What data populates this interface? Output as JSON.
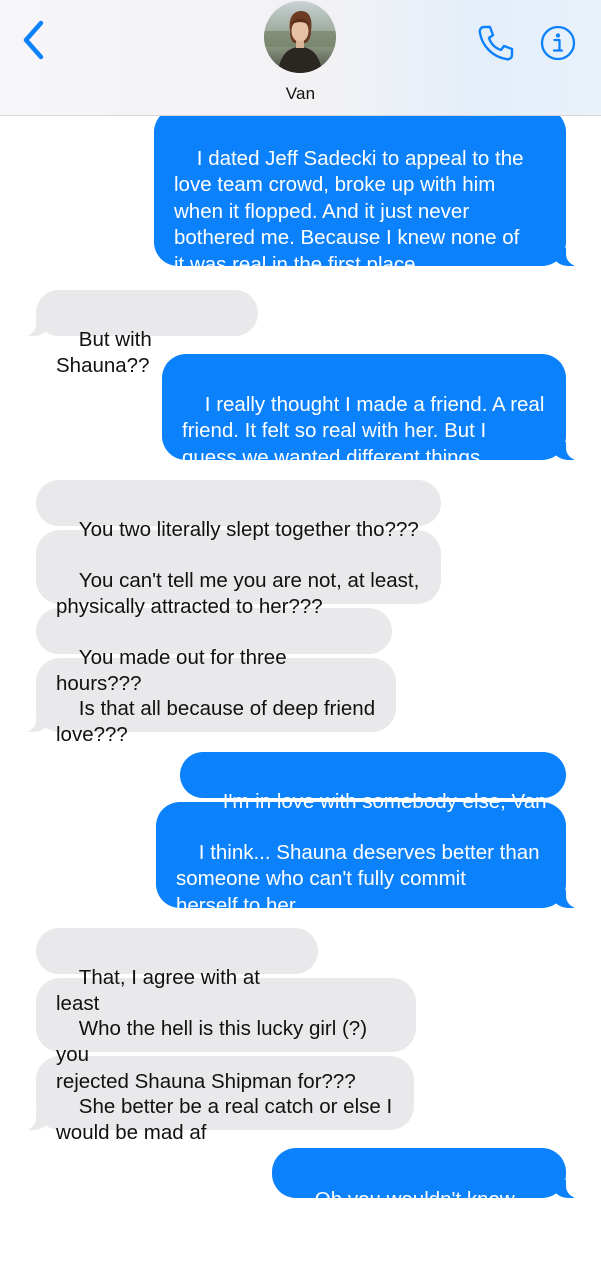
{
  "header": {
    "contact_name": "Van",
    "icons": {
      "back": "chevron-left-icon",
      "phone": "phone-icon",
      "info": "info-icon"
    },
    "accent_color": "#0b81fb"
  },
  "messages": [
    {
      "from": "me",
      "text": "I dated Jeff Sadecki to appeal to the\nlove team crowd, broke up with him\nwhen it flopped. And it just never\nbothered me. Because I knew none of\nit was real in the first place"
    },
    {
      "from": "them",
      "text": "But with Shauna??"
    },
    {
      "from": "me",
      "text": "I really thought I made a friend. A real\nfriend. It felt so real with her. But I\nguess we wanted different things"
    },
    {
      "from": "them",
      "text": "You two literally slept together tho???"
    },
    {
      "from": "them",
      "text": "You can't tell me you are not, at least,\nphysically attracted to her???"
    },
    {
      "from": "them",
      "text": "You made out for three hours???"
    },
    {
      "from": "them",
      "text": "Is that all because of deep friend\nlove???"
    },
    {
      "from": "me",
      "text": "I'm in love with somebody else, Van"
    },
    {
      "from": "me",
      "text": "I think... Shauna deserves better than\nsomeone who can't fully commit\nherself to her"
    },
    {
      "from": "them",
      "text": "That, I agree with at least"
    },
    {
      "from": "them",
      "text": "Who the hell is this lucky girl (?) you\nrejected Shauna Shipman for???"
    },
    {
      "from": "them",
      "text": "She better be a real catch or else I\nwould be mad af"
    },
    {
      "from": "me",
      "text": "Oh you wouldn't know her"
    }
  ],
  "colors": {
    "sent_bubble": "#0b81fb",
    "received_bubble": "#e9e9eb"
  }
}
